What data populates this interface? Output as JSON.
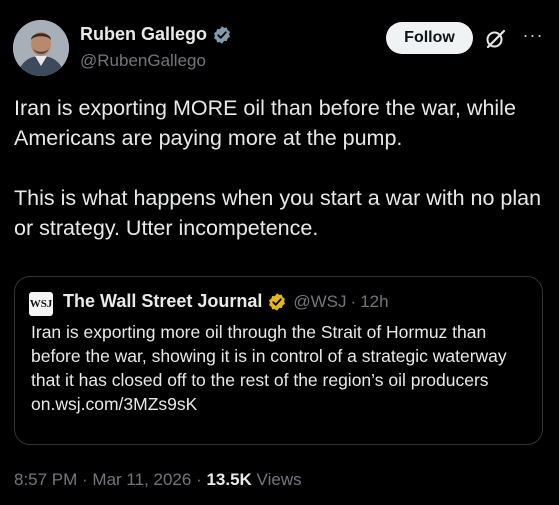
{
  "author": {
    "display_name": "Ruben Gallego",
    "handle": "@RubenGallego",
    "verified_color": "#829aab"
  },
  "actions": {
    "follow_label": "Follow",
    "more_label": "···"
  },
  "tweet": {
    "paragraphs": [
      "Iran is exporting MORE oil than before the war, while Americans are paying more at the pump.",
      "This is what happens when you start a war with no plan or strategy. Utter incompetence."
    ]
  },
  "quoted": {
    "logo_text": "WSJ",
    "display_name": "The Wall Street Journal",
    "badge_color": "#e2b719",
    "handle": "@WSJ",
    "separator": "·",
    "time": "12h",
    "text": "Iran is exporting more oil through the Strait of Hormuz than before the war, showing it is in control of a strategic waterway that it has closed off to the rest of the region’s oil producers on.wsj.com/3MZs9sK"
  },
  "meta": {
    "time": "8:57 PM",
    "sep1": " · ",
    "date": "Mar 11, 2026",
    "sep2": " · ",
    "views_count": "13.5K",
    "views_label": " Views"
  }
}
